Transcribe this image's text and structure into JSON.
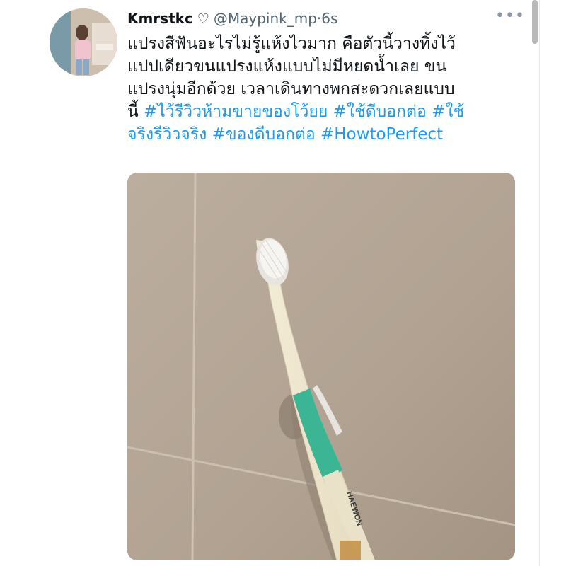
{
  "tweet": {
    "display_name": "Kmrstkc",
    "name_icon": "heart-outline-icon",
    "handle": "@Maypink_mp",
    "separator": "·",
    "time": "6s",
    "more_icon": "more-horizontal-icon",
    "text_lines": [
      "แปรงสีฟันอะไรไม่รู้แห้งไวมาก คือตัวนี้วางทิ้งไว้",
      "แปปเดียวขนแปรงแห้งแบบไม่มีหยดน้ำเลย ขน",
      "แปรงนุ่มอีกด้วย เวลาเดินทางพกสะดวกเลยแบบ"
    ],
    "line4_prefix": "นี้ ",
    "line4_hashtags": "#ไว้รีวิวห้ามขายของโว้ยย #ใช้ดีบอกต่อ #ใช้",
    "line5_hashtags": "จริงรีวิวจริง #ของดีบอกต่อ #HowtoPerfect",
    "photo_brand_text": "HAEWON"
  },
  "colors": {
    "hashtag": "#1d9bf0",
    "secondary_text": "#536471",
    "brush_green": "#3bb594"
  }
}
